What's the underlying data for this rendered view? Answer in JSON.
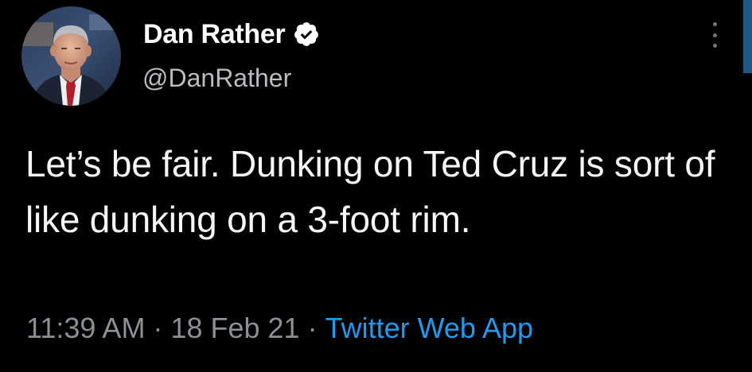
{
  "author": {
    "name": "Dan Rather",
    "handle": "@DanRather",
    "verified": true
  },
  "tweet": {
    "text": "Let’s be fair. Dunking on Ted Cruz is sort of like dunking on a 3-foot rim.",
    "time": "11:39 AM",
    "separator": "·",
    "date": "18 Feb 21",
    "source": "Twitter Web App"
  },
  "icons": {
    "verified": "verified-badge-icon",
    "more": "more-options-icon"
  },
  "colors": {
    "background": "#000000",
    "text": "#f5f6f7",
    "muted": "#8b9096",
    "link": "#1d9bf0"
  }
}
